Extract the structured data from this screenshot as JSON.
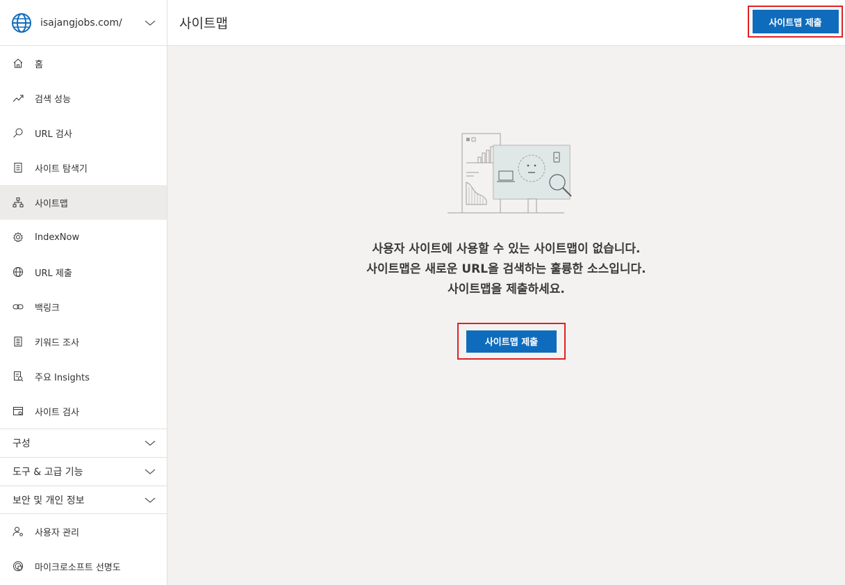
{
  "site": {
    "name": "isajangjobs.com/"
  },
  "header": {
    "title": "사이트맵",
    "submit_label": "사이트맵 제출"
  },
  "sidebar": {
    "items": [
      {
        "label": "홈",
        "icon": "home-icon"
      },
      {
        "label": "검색 성능",
        "icon": "trend-icon"
      },
      {
        "label": "URL 검사",
        "icon": "search-icon"
      },
      {
        "label": "사이트 탐색기",
        "icon": "document-icon"
      },
      {
        "label": "사이트맵",
        "icon": "sitemap-icon",
        "active": true
      },
      {
        "label": "IndexNow",
        "icon": "gear-icon"
      },
      {
        "label": "URL 제출",
        "icon": "globe-icon"
      },
      {
        "label": "백링크",
        "icon": "link-icon"
      },
      {
        "label": "키워드 조사",
        "icon": "list-icon"
      },
      {
        "label": "주요 Insights",
        "icon": "insights-icon"
      },
      {
        "label": "사이트 검사",
        "icon": "scan-icon"
      }
    ],
    "groups": [
      {
        "label": "구성"
      },
      {
        "label": "도구 & 고급 기능"
      },
      {
        "label": "보안 및 개인 정보"
      }
    ],
    "bottom_items": [
      {
        "label": "사용자 관리",
        "icon": "user-settings-icon"
      },
      {
        "label": "마이크로소프트 선명도",
        "icon": "clarity-icon"
      }
    ]
  },
  "empty_state": {
    "line1": "사용자 사이트에 사용할 수 있는 사이트맵이 없습니다.",
    "line2": "사이트맵은 새로운 URL을 검색하는 훌륭한 소스입니다.",
    "line3": "사이트맵을 제출하세요.",
    "button_label": "사이트맵 제출"
  },
  "colors": {
    "primary": "#0f6cbd",
    "highlight_border": "#e02020",
    "active_nav": "#edebe9"
  }
}
